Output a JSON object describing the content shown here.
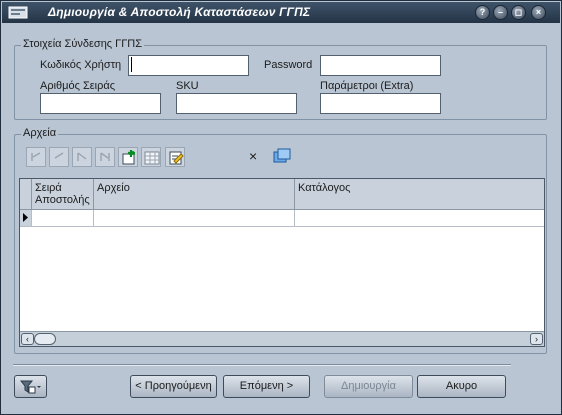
{
  "window": {
    "title": "Δημιουργία & Αποστολή Καταστάσεων ΓΓΠΣ"
  },
  "connection": {
    "group_title": "Στοιχεία Σύνδεσης ΓΓΠΣ",
    "username_label": "Κωδικός Χρήστη",
    "username_value": "",
    "password_label": "Password",
    "password_value": "",
    "serial_label": "Αριθμός Σειράς",
    "serial_value": "",
    "sku_label": "SKU",
    "sku_value": "",
    "extra_label": "Παράμετροι (Extra)",
    "extra_value": ""
  },
  "files": {
    "group_title": "Αρχεία",
    "toolbar_icons": [
      "first-record-icon",
      "previous-record-icon",
      "next-record-icon",
      "last-record-icon",
      "add-record-icon",
      "grid-view-icon",
      "edit-record-icon",
      "delete-icon",
      "browse-folder-icon"
    ],
    "columns": [
      "Σειρά Αποστολής",
      "Αρχείο",
      "Κατάλογος"
    ],
    "rows": [
      [
        "",
        "",
        ""
      ]
    ]
  },
  "footer": {
    "previous_label": "< Προηγούμενη",
    "next_label": "Επόμενη >",
    "create_label": "Δημιουργία",
    "cancel_label": "Ακυρο"
  }
}
